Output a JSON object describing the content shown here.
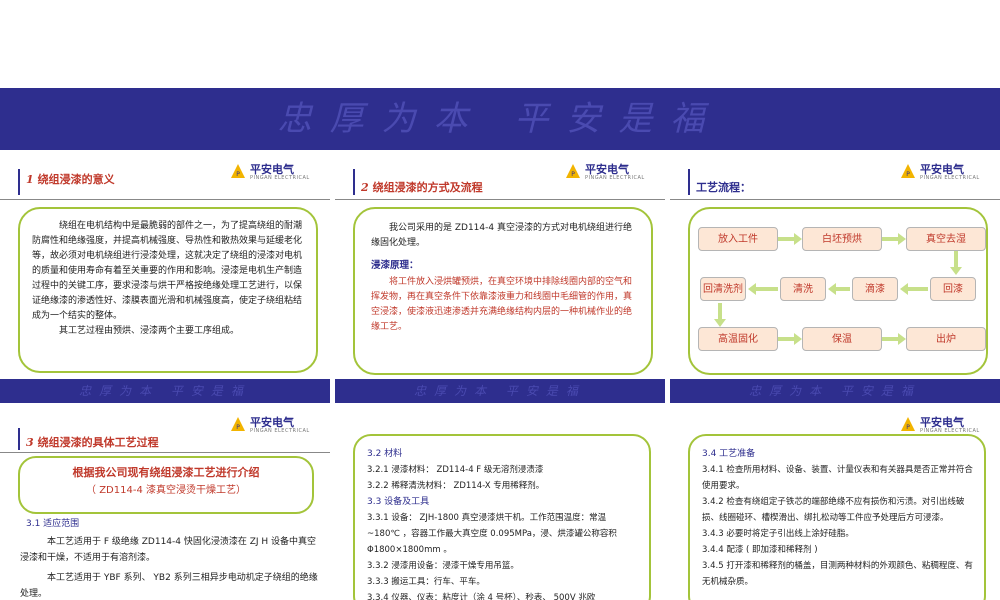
{
  "banner": {
    "motto": "忠厚为本 平安是福"
  },
  "logo": {
    "brand": "平安电气",
    "brand_en": "PINGAN ELECTRICAL"
  },
  "footer": {
    "motto": "忠厚为本 平安是福"
  },
  "slide1": {
    "num": "1",
    "title": "绕组浸漆的意义",
    "para1": "绕组在电机结构中是最脆弱的部件之一，为了提高绕组的耐潮防腐性和绝缘强度，并提高机械强度、导热性和散热效果与延缓老化等，故必须对电机绕组进行浸漆处理，这就决定了绕组的浸漆对电机的质量和使用寿命有着至关重要的作用和影响。浸漆是电机生产制造过程中的关键工序，要求浸漆与烘干严格按绝缘处理工艺进行，以保证绝缘漆的渗透性好、漆膜表面光滑和机械强度高，使定子绕组粘结成为一个结实的整体。",
    "para2": "其工艺过程由预烘、浸漆两个主要工序组成。"
  },
  "slide2": {
    "num": "2",
    "title": "绕组浸漆的方式及流程",
    "para1": "我公司采用的是 ZD114-4 真空浸漆的方式对电机绕组进行绝缘固化处理。",
    "principle_title": "浸漆原理：",
    "principle": "将工件放入浸烘罐预烘，在真空环境中排除线圈内部的空气和挥发物，再在真空条件下依靠漆液重力和线圈中毛细管的作用，真空浸漆，使漆液迅速渗透并充满绝缘结构内层的一种机械作业的绝缘工艺。"
  },
  "slide3": {
    "title": "工艺流程：",
    "flow": {
      "row1": [
        "放入工件",
        "白坯预烘",
        "真空去湿"
      ],
      "row2": [
        "回清洗剂",
        "清洗",
        "滴漆",
        "回漆"
      ],
      "row3": [
        "高温固化",
        "保温",
        "出炉"
      ]
    }
  },
  "slide4": {
    "num": "3",
    "title": "绕组浸漆的具体工艺过程",
    "intro1": "根据我公司现有绕组浸漆工艺进行介绍",
    "intro2": "（ ZD114-4 漆真空浸烫干燥工艺）",
    "sec1": "3.1  适应范围",
    "para1": "本工艺适用于 F 级绝缘 ZD114-4 快固化浸渍漆在 ZJ H 设备中真空浸漆和干燥，不适用于有溶剂漆。",
    "para2": "本工艺适用于 YBF 系列、 YB2 系列三相异步电动机定子绕组的绝缘处理。"
  },
  "slide5": {
    "items": [
      {
        "kind": "sh",
        "text": "3.2  材料"
      },
      {
        "kind": "li",
        "text": "3.2.1  浸漆材料： ZD114-4  F 级无溶剂浸渍漆"
      },
      {
        "kind": "li",
        "text": "3.2.2  稀释清洗材料： ZD114-X  专用稀释剂。"
      },
      {
        "kind": "sh",
        "text": "3.3  设备及工具"
      },
      {
        "kind": "li",
        "text": "3.3.1  设备： ZJH-1800 真空浸漆烘干机。工作范围温度：常温~180℃ ，容器工作最大真空度 0.095MPa，浸、烘漆罐公称容积 Φ1800×1800mm 。"
      },
      {
        "kind": "li",
        "text": "3.3.2  浸漆用设备：浸漆干燥专用吊篮。"
      },
      {
        "kind": "li",
        "text": "3.3.3  搬运工具：行车、平车。"
      },
      {
        "kind": "li",
        "text": "3.3.4  仪器、仪表：粘度计（涂 4 号杯）、秒表、  500V 兆欧"
      }
    ]
  },
  "slide6": {
    "items": [
      {
        "kind": "sh",
        "text": "3.4  工艺准备"
      },
      {
        "kind": "li",
        "text": "3.4.1  检查所用材料、设备、装置、计量仪表和有关器具是否正常并符合使用要求。"
      },
      {
        "kind": "li",
        "text": "3.4.2  检查有绕组定子铁芯的端部绝缘不应有损伤和污渍。对引出线破损、线圈碰环、槽楔滑出、绑扎松动等工件应予处理后方可浸漆。"
      },
      {
        "kind": "li",
        "text": "3.4.3  必要时将定子引出线上涂好硅脂。"
      },
      {
        "kind": "li",
        "text": "3.4.4  配漆 ( 即加漆和稀释剂 )"
      },
      {
        "kind": "li",
        "text": "3.4.5  打开漆和稀释剂的桶盖，目测两种材料的外观颜色、粘稠程度、有无机械杂质。"
      }
    ]
  }
}
